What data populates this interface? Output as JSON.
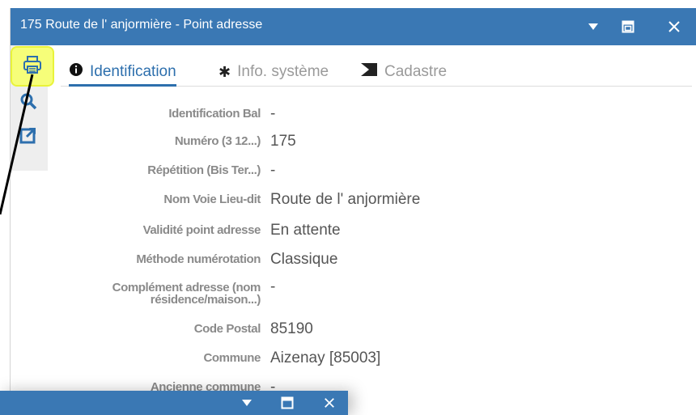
{
  "window": {
    "title": "175 Route de l' anjormière - Point adresse",
    "buttons": {
      "collapse_icon": "chevron-down-icon",
      "restore_icon": "window-restore-icon",
      "close_icon": "close-icon"
    }
  },
  "toolstrip": {
    "items": [
      {
        "icon": "print-icon",
        "highlighted": true
      },
      {
        "icon": "search-icon",
        "highlighted": false
      },
      {
        "icon": "external-link-icon",
        "highlighted": false
      }
    ]
  },
  "tabs": [
    {
      "label": "Identification",
      "icon": "info-icon",
      "active": true
    },
    {
      "label": "Info. système",
      "icon": "gear-icon",
      "active": false
    },
    {
      "label": "Cadastre",
      "icon": "cadastre-icon",
      "active": false
    }
  ],
  "fields": [
    {
      "label": "Identification Bal",
      "value": "-"
    },
    {
      "label": "Numéro (3 12...)",
      "value": "175"
    },
    {
      "label": "Répétition (Bis Ter...)",
      "value": "-"
    },
    {
      "label": "Nom Voie Lieu-dit",
      "value": "Route de l' anjormière"
    },
    {
      "label": "Validité point adresse",
      "value": "En attente"
    },
    {
      "label": "Méthode numérotation",
      "value": "Classique"
    },
    {
      "label": "Complément adresse (nom résidence/maison...)",
      "value": "-"
    },
    {
      "label": "Code Postal",
      "value": "85190"
    },
    {
      "label": "Commune",
      "value": "Aizenay [85003]"
    },
    {
      "label": "Ancienne commune",
      "value": "-"
    }
  ],
  "colors": {
    "titlebar": "#3a78b4",
    "accent": "#2d6fad",
    "highlight": "#f6fe79"
  }
}
